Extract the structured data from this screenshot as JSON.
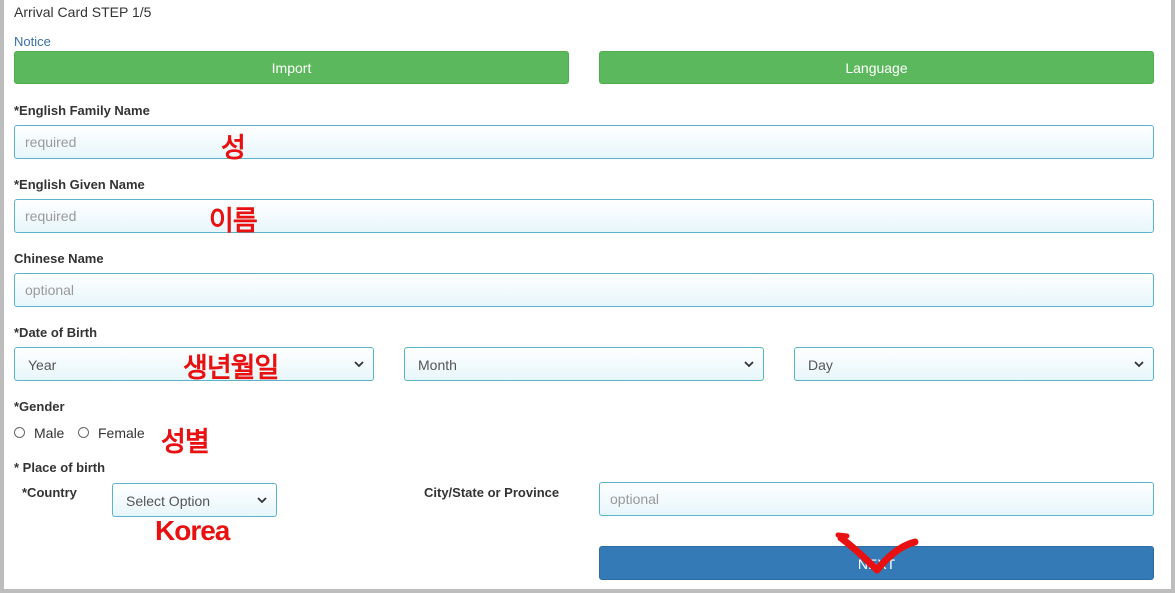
{
  "header": {
    "title": "Arrival Card STEP 1/5",
    "notice": "Notice"
  },
  "buttons": {
    "import": "Import",
    "language": "Language",
    "next": "NEXT"
  },
  "fields": {
    "family_name": {
      "label": "*English Family Name",
      "placeholder": "required",
      "annotation": "성"
    },
    "given_name": {
      "label": "*English Given Name",
      "placeholder": "required",
      "annotation": "이름"
    },
    "chinese_name": {
      "label": "Chinese Name",
      "placeholder": "optional"
    },
    "dob": {
      "label": "*Date of Birth",
      "year": "Year",
      "month": "Month",
      "day": "Day",
      "annotation": "생년월일"
    },
    "gender": {
      "label": "*Gender",
      "male": "Male",
      "female": "Female",
      "annotation": "성별"
    },
    "place_of_birth": {
      "label": "* Place of birth",
      "country_label": "*Country",
      "country_value": "Select Option",
      "country_annotation": "Korea",
      "city_label": "City/State or Province",
      "city_placeholder": "optional"
    }
  },
  "colors": {
    "green_button": "#5cb85c",
    "blue_button": "#337ab7",
    "annotation_red": "#e81010",
    "input_border": "#5bb3c9"
  }
}
